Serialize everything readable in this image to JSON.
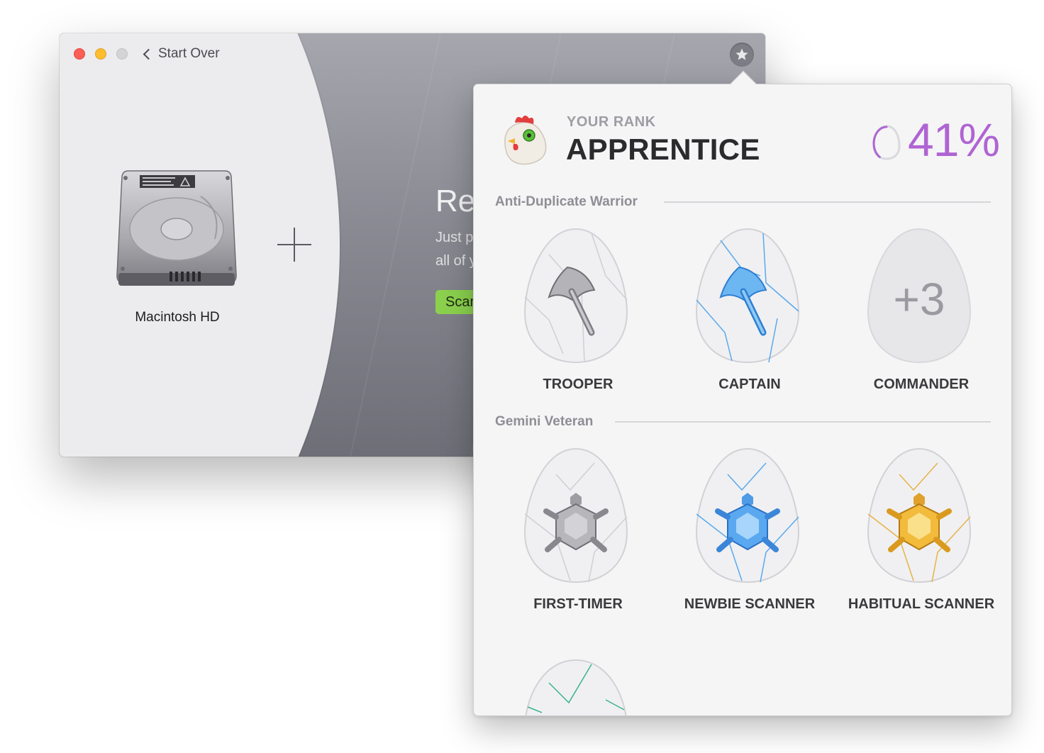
{
  "window": {
    "back_label": "Start Over",
    "disk_name": "Macintosh HD",
    "hero_title": "Rea",
    "hero_line1": "Just p",
    "hero_line2": "all of y",
    "scan_label": "Scan",
    "accent_green": "#8bd14e"
  },
  "rank": {
    "label": "YOUR RANK",
    "name": "APPRENTICE",
    "percent_text": "41%",
    "progress": 0.41,
    "accent_color": "#b064d2"
  },
  "sections": [
    {
      "title": "Anti-Duplicate Warrior",
      "badges": [
        {
          "name": "TROOPER",
          "icon": "axe-silver-icon"
        },
        {
          "name": "CAPTAIN",
          "icon": "axe-blue-icon"
        },
        {
          "name": "COMMANDER",
          "icon": "locked-egg-icon",
          "more": "+3"
        }
      ]
    },
    {
      "title": "Gemini Veteran",
      "badges": [
        {
          "name": "FIRST-TIMER",
          "icon": "turtle-silver-icon"
        },
        {
          "name": "NEWBIE SCANNER",
          "icon": "turtle-blue-icon"
        },
        {
          "name": "HABITUAL SCANNER",
          "icon": "turtle-gold-icon"
        }
      ]
    }
  ]
}
